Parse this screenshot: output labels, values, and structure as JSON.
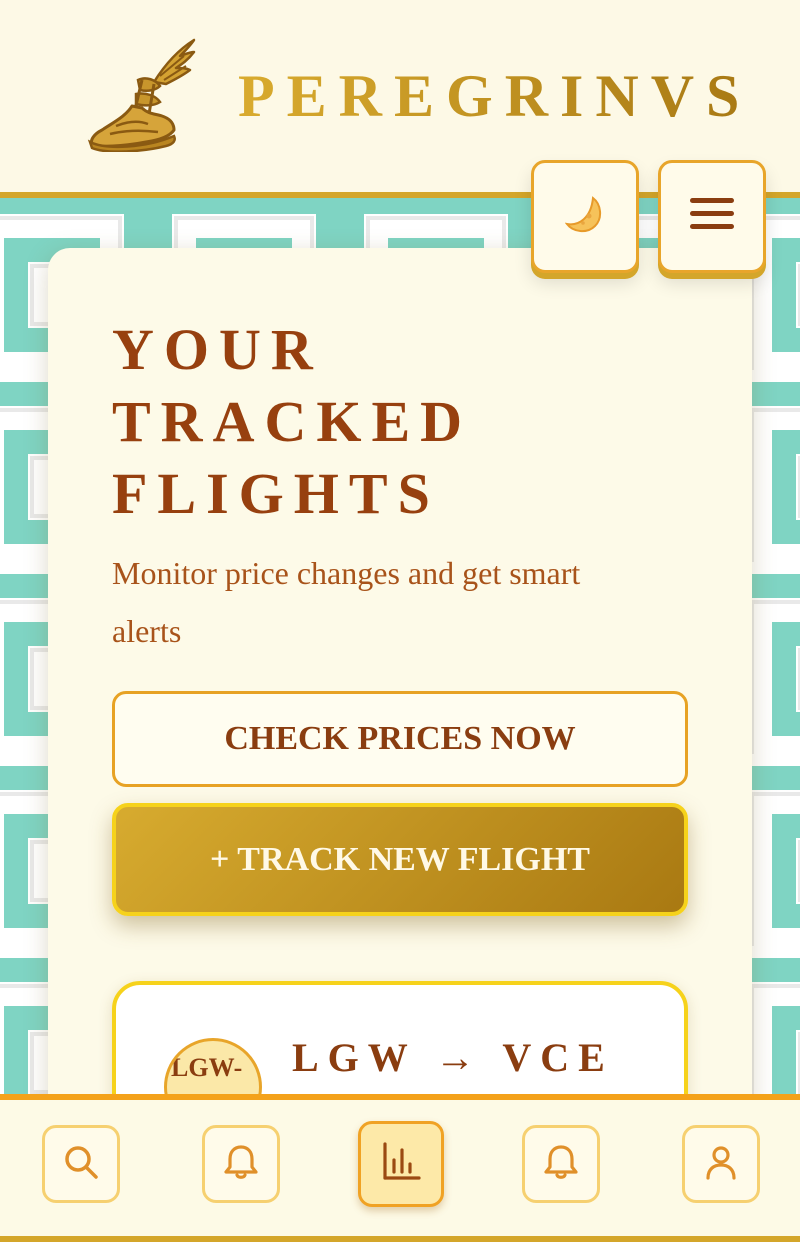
{
  "header": {
    "brand": "PEREGRINVS",
    "logo_icon": "winged-sandal-icon",
    "theme_toggle_icon": "crescent-moon-icon",
    "menu_icon": "hamburger-menu-icon"
  },
  "main": {
    "title_lines": [
      "YOUR",
      "TRACKED",
      "FLIGHTS"
    ],
    "subtitle": "Monitor price changes and get smart alerts",
    "check_prices_label": "CHECK PRICES NOW",
    "track_new_label": "+ TRACK NEW FLIGHT"
  },
  "flight": {
    "avatar_text": "LGW-",
    "route": "LGW → VCE"
  },
  "bottom_nav": {
    "items": [
      {
        "icon": "search-icon",
        "active": false
      },
      {
        "icon": "bell-icon",
        "active": false
      },
      {
        "icon": "bar-chart-icon",
        "active": true
      },
      {
        "icon": "bell-icon",
        "active": false
      },
      {
        "icon": "user-icon",
        "active": false
      }
    ]
  },
  "colors": {
    "gold": "#d4a62a",
    "brown": "#97400f",
    "teal": "#7dd4c4",
    "cream": "#fdfae8",
    "orange": "#f4a21a"
  }
}
